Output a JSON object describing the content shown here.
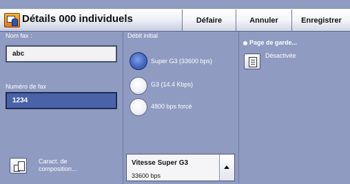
{
  "header": {
    "title": "Détails 000 individuels",
    "buttons": {
      "undo": "Défaire",
      "cancel": "Annuler",
      "save": "Enregistrer"
    }
  },
  "fax_name": {
    "label": "Nom fax :",
    "value": "abc"
  },
  "fax_number": {
    "label": "Numéro de fax",
    "value": "1234"
  },
  "initial_rate": {
    "label": "Débit initial",
    "options": [
      {
        "label": "Super G3 (33600 bps)",
        "selected": true
      },
      {
        "label": "G3 (14.4 Kbps)",
        "selected": false
      },
      {
        "label": "4800 bps forcé",
        "selected": false
      }
    ]
  },
  "cover_page": {
    "title": "Page de garde...",
    "status": "Désactivée"
  },
  "composition": {
    "label_line1": "Caract. de",
    "label_line2": "composition..."
  },
  "speed": {
    "title": "Vitesse Super G3",
    "value": "33600 bps"
  },
  "colors": {
    "background": "#8f9bc1",
    "selected_field": "#4a62a8",
    "selected_radio": "#4468c3"
  }
}
